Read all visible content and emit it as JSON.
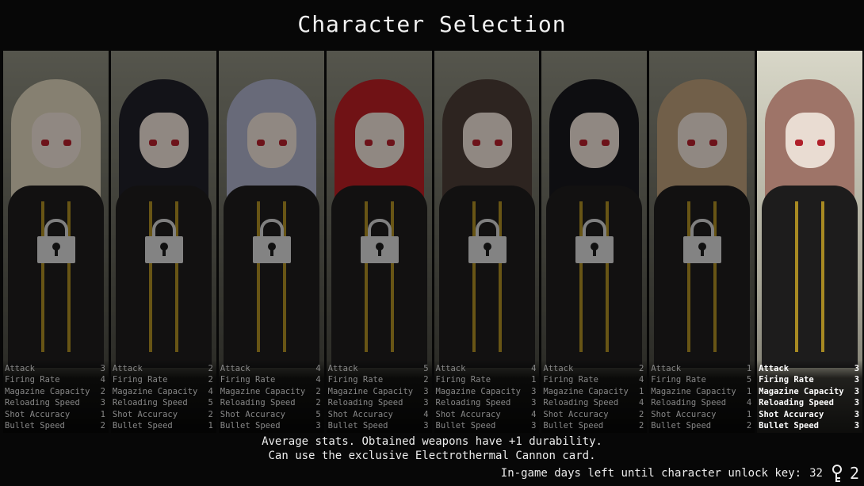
{
  "title": "Character Selection",
  "stat_labels": [
    "Attack",
    "Firing Rate",
    "Magazine Capacity",
    "Reloading Speed",
    "Shot Accuracy",
    "Bullet Speed"
  ],
  "characters": [
    {
      "hair": "#d8cfb6",
      "locked": true,
      "stats": [
        "3",
        "4",
        "2",
        "3",
        "1",
        "2"
      ]
    },
    {
      "hair": "#1f1f28",
      "locked": true,
      "stats": [
        "2",
        "2",
        "4",
        "5",
        "2",
        "1"
      ]
    },
    {
      "hair": "#a9acc4",
      "locked": true,
      "stats": [
        "4",
        "4",
        "2",
        "2",
        "5",
        "3"
      ]
    },
    {
      "hair": "#b51e22",
      "locked": true,
      "stats": [
        "5",
        "2",
        "3",
        "3",
        "4",
        "3"
      ]
    },
    {
      "hair": "#4a3a34",
      "locked": true,
      "stats": [
        "4",
        "1",
        "3",
        "3",
        "4",
        "3"
      ]
    },
    {
      "hair": "#18171c",
      "locked": true,
      "stats": [
        "2",
        "4",
        "1",
        "4",
        "2",
        "2"
      ]
    },
    {
      "hair": "#b69a76",
      "locked": true,
      "stats": [
        "1",
        "5",
        "1",
        "4",
        "1",
        "2"
      ]
    },
    {
      "hair": "#9e7468",
      "locked": false,
      "stats": [
        "3",
        "3",
        "3",
        "3",
        "3",
        "3"
      ]
    }
  ],
  "description": {
    "line1": "Average stats. Obtained weapons have +1 durability.",
    "line2": "Can use the exclusive Electrothermal Cannon card."
  },
  "unlock": {
    "label": "In-game days left until character unlock key:",
    "days": "32",
    "key_count": "2"
  }
}
